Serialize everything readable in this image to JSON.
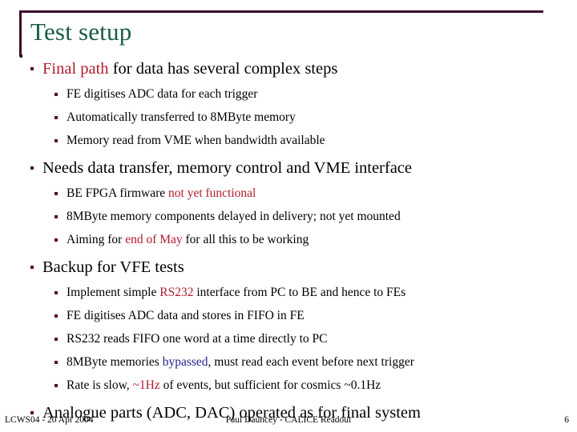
{
  "slide": {
    "title": "Test setup",
    "title_color": "#1a5c42",
    "rule_color": "#3d0b2b",
    "bullet_color": "#5c1020",
    "accent_red": "#b01b2e",
    "accent_blue": "#1f1f8f"
  },
  "bullets": {
    "b1": {
      "pre": "",
      "accent": "Final path",
      "post": " for data has several complex steps",
      "subs": [
        "FE digitises ADC data for each trigger",
        "Automatically transferred to 8MByte memory",
        "Memory read from VME when bandwidth available"
      ]
    },
    "b2": {
      "text": "Needs data transfer, memory control and VME interface",
      "sub1_pre": "BE FPGA firmware ",
      "sub1_accent": "not yet functional",
      "sub1_post": "",
      "sub2": "8MByte memory components delayed in delivery; not yet mounted",
      "sub3_pre": "Aiming for ",
      "sub3_accent": "end of May",
      "sub3_post": " for all this to be working"
    },
    "b3": {
      "text": "Backup for VFE tests",
      "sub1_pre": "Implement simple ",
      "sub1_accent": "RS232",
      "sub1_post": " interface from PC to BE and hence to FEs",
      "sub2": "FE digitises ADC data and stores in FIFO in FE",
      "sub3": "RS232 reads FIFO one word at a time directly to PC",
      "sub4_pre": "8MByte memories ",
      "sub4_accent": "bypassed",
      "sub4_post": ", must read each event before next trigger",
      "sub5_pre": "Rate is slow, ",
      "sub5_accent": "~1Hz",
      "sub5_post": " of events, but sufficient for cosmics ~0.1Hz"
    },
    "b4": {
      "text": "Analogue parts (ADC, DAC) operated as for final system"
    }
  },
  "footer": {
    "left": "LCWS04 - 20 Apr 2004",
    "center": "Paul Dauncey - CALICE Readout",
    "page": "6"
  }
}
